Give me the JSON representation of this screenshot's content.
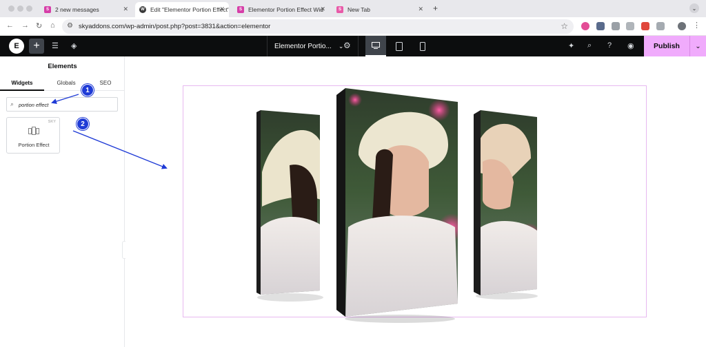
{
  "browser": {
    "tabs": [
      {
        "label": "2 new messages",
        "favicon": "sky-icon",
        "active": false
      },
      {
        "label": "Edit \"Elementor Portion Effect\"",
        "favicon": "wordpress-icon",
        "active": true
      },
      {
        "label": "Elementor Portion Effect Wid",
        "favicon": "sky-icon",
        "active": false
      },
      {
        "label": "New Tab",
        "favicon": "sky-icon",
        "active": false
      }
    ],
    "url": "skyaddons.com/wp-admin/post.php?post=3831&action=elementor"
  },
  "editor": {
    "document_title": "Elementor Portio...",
    "publish_label": "Publish"
  },
  "panel": {
    "title": "Elements",
    "tabs": [
      "Widgets",
      "Globals",
      "SEO"
    ],
    "search_value": "portion effect",
    "widget": {
      "badge": "SKY",
      "label": "Portion Effect"
    }
  },
  "annotations": {
    "step1": "1",
    "step2": "2",
    "color": "#1f3bd6"
  },
  "colors": {
    "accent": "#f0abfc",
    "topbar": "#0c0d0e",
    "section_outline": "#e7b8f0"
  }
}
